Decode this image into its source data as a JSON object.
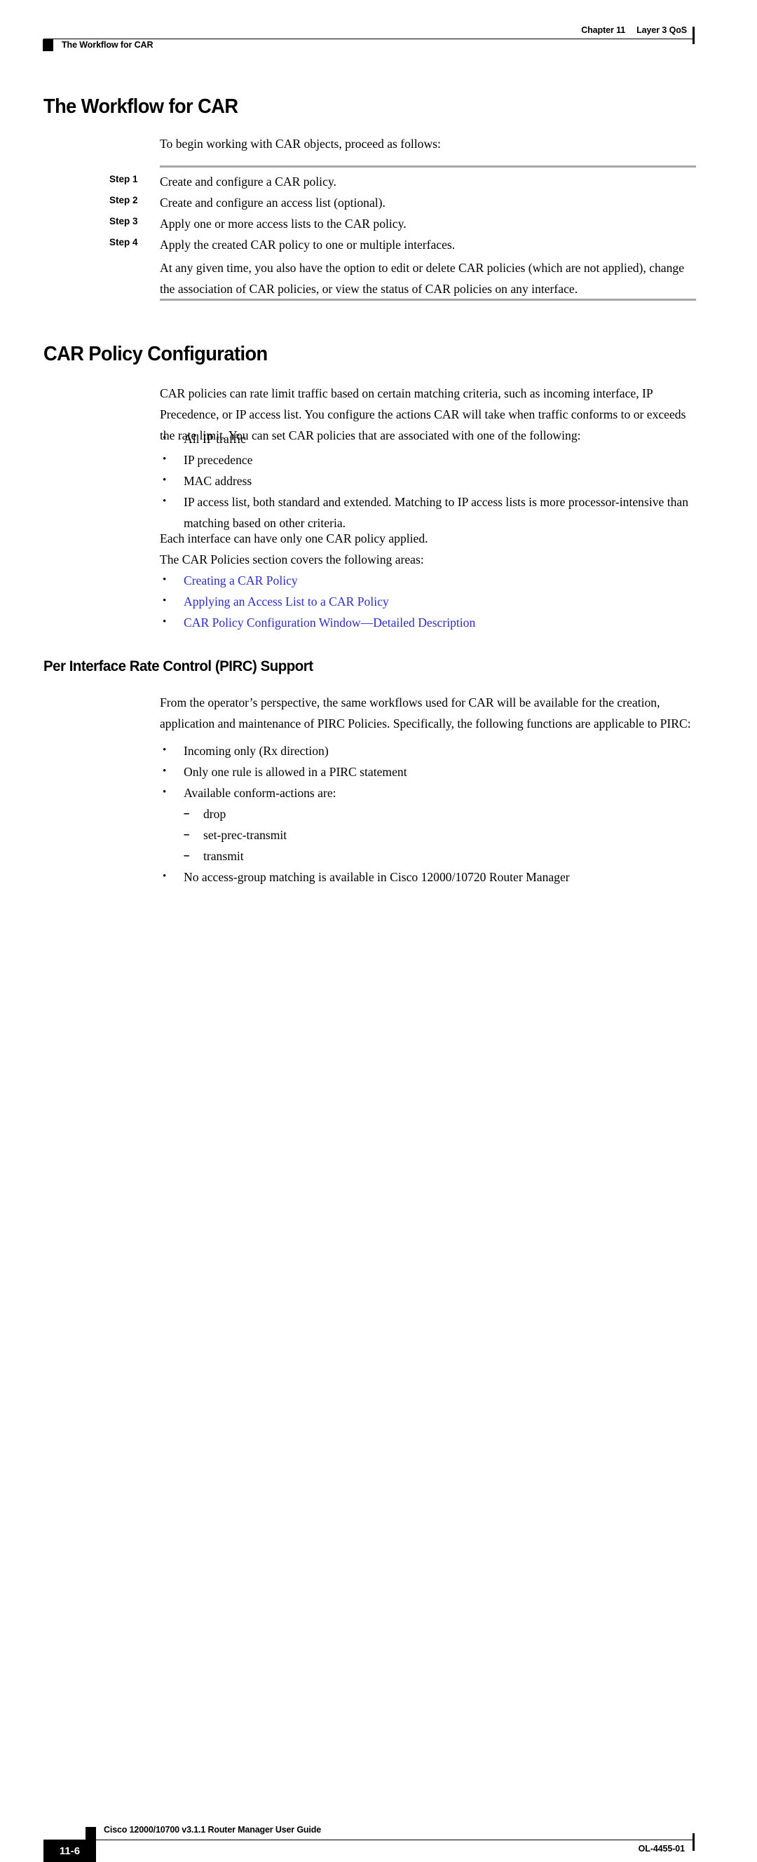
{
  "header": {
    "chapter_label": "Chapter 11",
    "chapter_title": "Layer 3 QoS",
    "section_marker": "The Workflow for CAR"
  },
  "sections": {
    "workflow": {
      "heading": "The Workflow for CAR",
      "intro": "To begin working with CAR objects, proceed as follows:",
      "steps": [
        {
          "label": "Step 1",
          "text": "Create and configure a CAR policy."
        },
        {
          "label": "Step 2",
          "text": "Create and configure an access list (optional)."
        },
        {
          "label": "Step 3",
          "text": "Apply one or more access lists to the CAR policy."
        },
        {
          "label": "Step 4",
          "text": "Apply the created CAR policy to one or multiple interfaces."
        }
      ],
      "closing": "At any given time, you also have the option to edit or delete CAR policies (which are not applied), change the association of CAR policies, or view the status of CAR policies on any interface."
    },
    "car_policy_configuration": {
      "heading": "CAR Policy Configuration",
      "intro": "CAR policies can rate limit traffic based on certain matching criteria, such as incoming interface, IP Precedence, or IP access list. You configure the actions CAR will take when traffic conforms to or exceeds the rate limit. You can set CAR policies that are associated with one of the following:",
      "criteria_bullets": [
        "All IP traffic",
        "IP precedence",
        "MAC address",
        "IP access list, both standard and extended. Matching to IP access lists is more processor-intensive than matching based on other criteria."
      ],
      "note_single_policy": "Each interface can have only one CAR policy applied.",
      "areas_intro": "The CAR Policies section covers the following areas:",
      "area_links": [
        "Creating a CAR Policy",
        "Applying an Access List to a CAR Policy",
        "CAR Policy Configuration Window—Detailed Description"
      ]
    },
    "pirc": {
      "heading": "Per Interface Rate Control (PIRC) Support",
      "intro": "From the operator’s perspective, the same workflows used for CAR will be available for the creation, application and maintenance of PIRC Policies. Specifically, the following functions are applicable to PIRC:",
      "bullets": [
        "Incoming only (Rx direction)",
        "Only one rule is allowed in a PIRC statement",
        "Available conform-actions are:"
      ],
      "conform_actions": [
        "drop",
        "set-prec-transmit",
        "transmit"
      ],
      "final_bullet": "No access-group matching is available in Cisco 12000/10720 Router Manager"
    }
  },
  "footer": {
    "page_number": "11-6",
    "document_title": "Cisco 12000/10700 v3.1.1 Router Manager User Guide",
    "doc_id": "OL-4455-01"
  },
  "colors": {
    "link": "#2b2bd4",
    "rule_gray": "#a6a6a6",
    "text": "#000000"
  },
  "glyphs": {
    "bullet": "•",
    "dash": "–"
  }
}
